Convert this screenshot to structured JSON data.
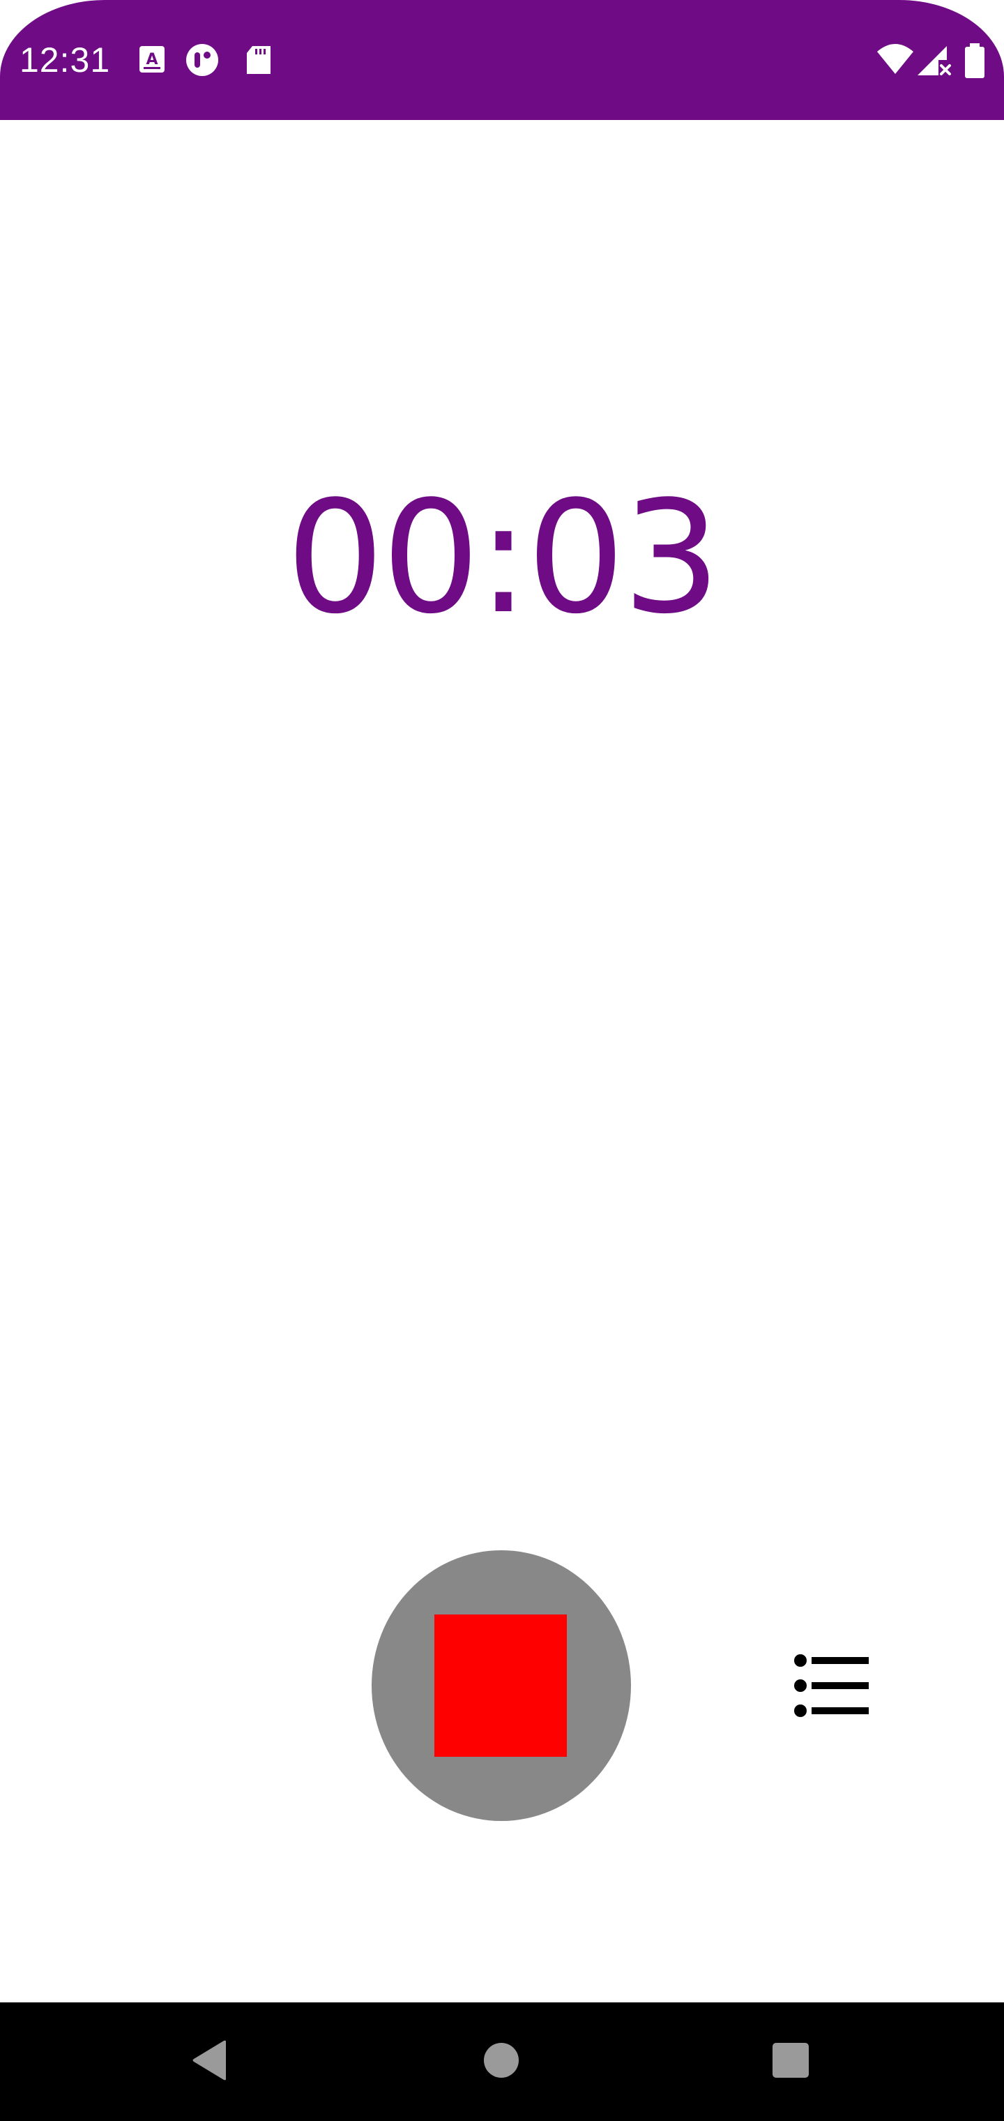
{
  "status_bar": {
    "time": "12:31",
    "left_icons": [
      "font-download-icon",
      "podcast-app-icon",
      "sd-card-icon"
    ],
    "right_icons": [
      "wifi-icon",
      "cell-signal-off-icon",
      "battery-icon"
    ],
    "color": "#6e0b85"
  },
  "timer": {
    "value": "00:03",
    "color": "#6e0b85"
  },
  "controls": {
    "record_button_state": "recording",
    "record_button_color": "#888888",
    "stop_icon_color": "#ff0000",
    "list_icon": "list-icon"
  },
  "nav_bar": {
    "buttons": [
      "back-icon",
      "home-icon",
      "recents-icon"
    ]
  }
}
